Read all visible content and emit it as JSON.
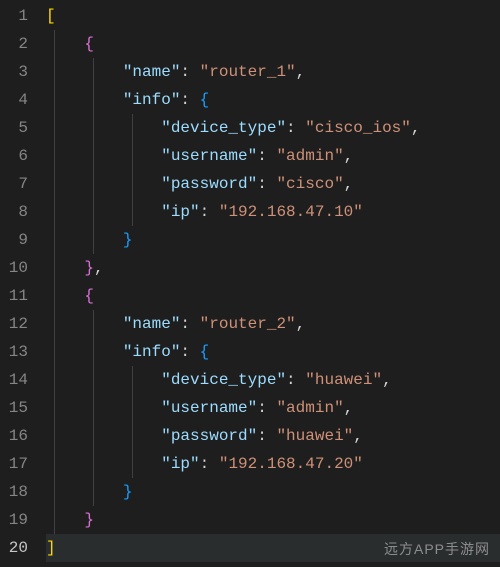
{
  "editor": {
    "activeLine": 20,
    "totalLines": 20,
    "lineNumbers": [
      "1",
      "2",
      "3",
      "4",
      "5",
      "6",
      "7",
      "8",
      "9",
      "10",
      "11",
      "12",
      "13",
      "14",
      "15",
      "16",
      "17",
      "18",
      "19",
      "20"
    ]
  },
  "code": {
    "l1_open": "[",
    "l2_open": "{",
    "l3_key": "\"name\"",
    "l3_val": "\"router_1\"",
    "l4_key": "\"info\"",
    "l4_open": "{",
    "l5_key": "\"device_type\"",
    "l5_val": "\"cisco_ios\"",
    "l6_key": "\"username\"",
    "l6_val": "\"admin\"",
    "l7_key": "\"password\"",
    "l7_val": "\"cisco\"",
    "l8_key": "\"ip\"",
    "l8_val": "\"192.168.47.10\"",
    "l9_close": "}",
    "l10_close": "}",
    "l11_open": "{",
    "l12_key": "\"name\"",
    "l12_val": "\"router_2\"",
    "l13_key": "\"info\"",
    "l13_open": "{",
    "l14_key": "\"device_type\"",
    "l14_val": "\"huawei\"",
    "l15_key": "\"username\"",
    "l15_val": "\"admin\"",
    "l16_key": "\"password\"",
    "l16_val": "\"huawei\"",
    "l17_key": "\"ip\"",
    "l17_val": "\"192.168.47.20\"",
    "l18_close": "}",
    "l19_close": "}",
    "l20_close": "]",
    "colon": ":",
    "comma": ",",
    "space": " "
  },
  "watermark": "远方APP手游网"
}
